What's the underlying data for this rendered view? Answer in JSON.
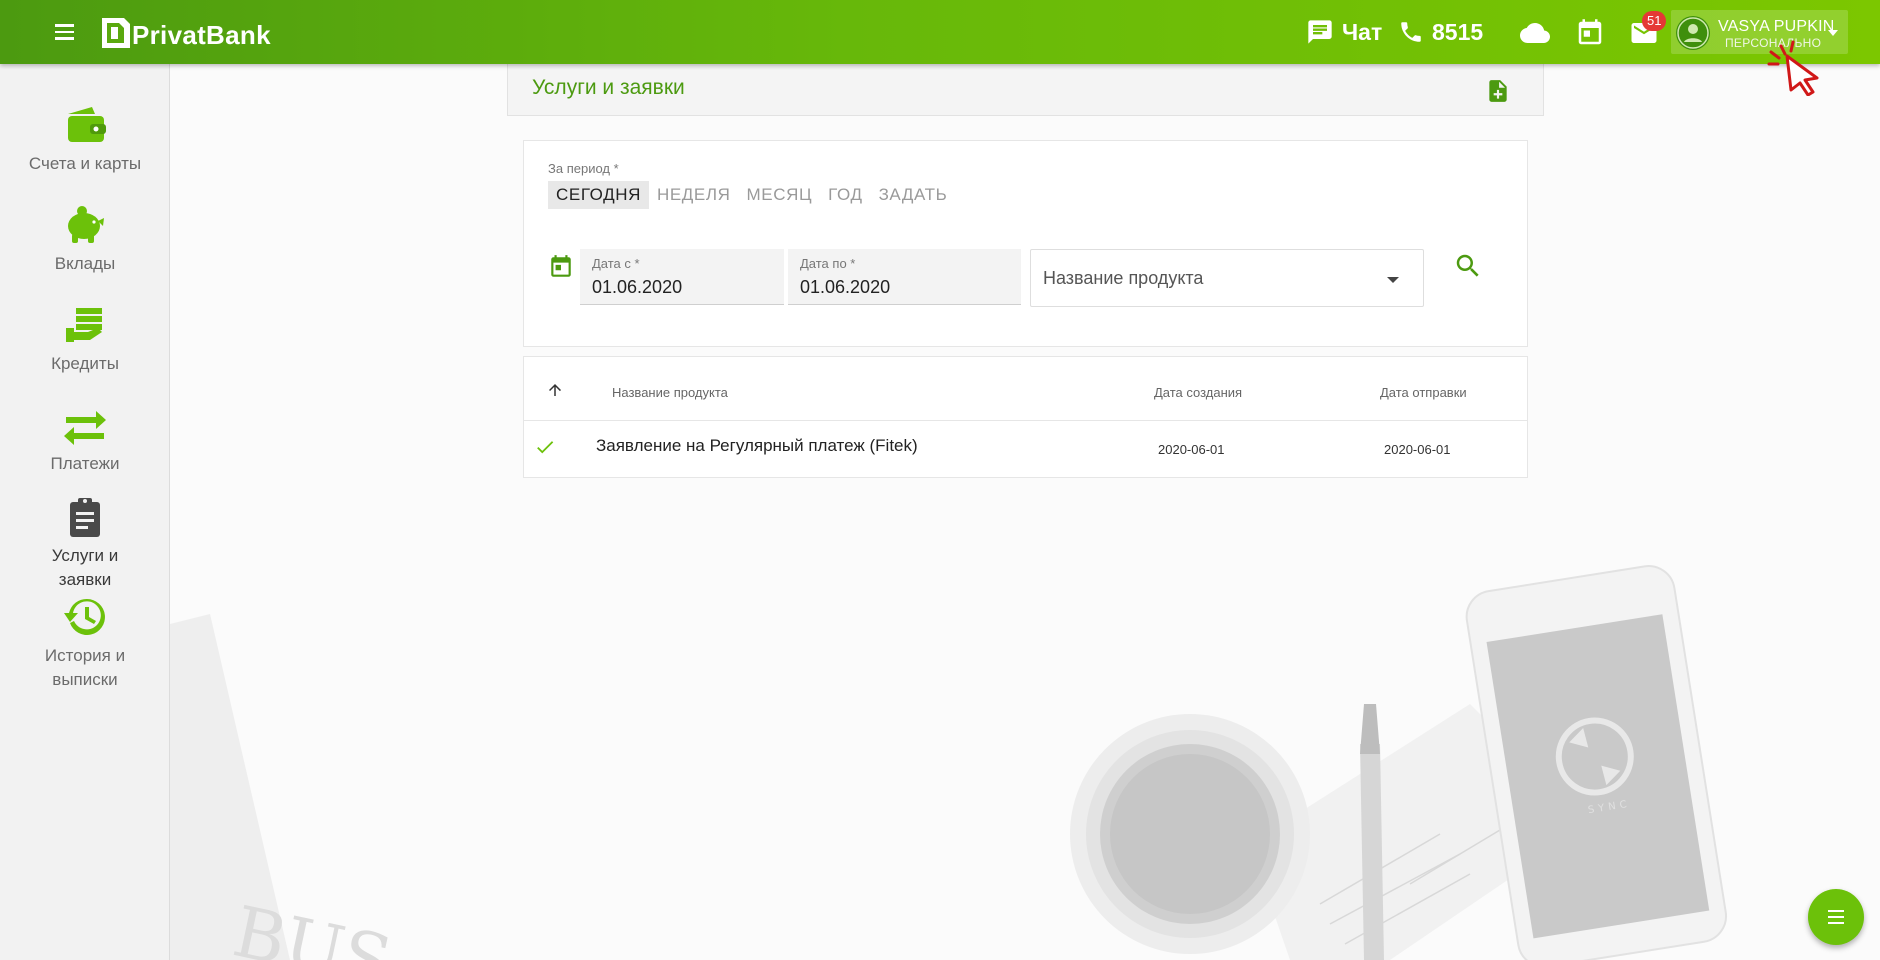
{
  "header": {
    "brand": "PrivatBank",
    "chat_label": "Чат",
    "phone_label": "8515",
    "mail_badge": "51",
    "user_name": "VASYA PUPKIN",
    "user_role": "ПЕРСОНАЛЬНО",
    "accent_color": "#6cc10a"
  },
  "sidebar": {
    "items": [
      {
        "label": "Счета и карты",
        "icon": "wallet-icon"
      },
      {
        "label": "Вклады",
        "icon": "piggy-bank-icon"
      },
      {
        "label": "Кредиты",
        "icon": "credit-hand-icon"
      },
      {
        "label": "Платежи",
        "icon": "transfer-arrows-icon"
      },
      {
        "label_line1": "Услуги и",
        "label_line2": "заявки",
        "icon": "clipboard-icon",
        "active": true
      },
      {
        "label_line1": "История и",
        "label_line2": "выписки",
        "icon": "history-icon"
      }
    ]
  },
  "page": {
    "title": "Услуги и заявки"
  },
  "filter": {
    "period_label": "За период *",
    "periods": [
      "СЕГОДНЯ",
      "НЕДЕЛЯ",
      "МЕСЯЦ",
      "ГОД",
      "ЗАДАТЬ"
    ],
    "active_period": "СЕГОДНЯ",
    "date_from_label": "Дата с *",
    "date_from_value": "01.06.2020",
    "date_to_label": "Дата по *",
    "date_to_value": "01.06.2020",
    "product_placeholder": "Название продукта"
  },
  "table": {
    "columns": {
      "name": "Название продукта",
      "created": "Дата создания",
      "sent": "Дата отправки"
    },
    "rows": [
      {
        "name": "Заявление на Регулярный платеж (Fitek)",
        "created": "2020-06-01",
        "sent": "2020-06-01",
        "status": "check-icon"
      }
    ]
  }
}
